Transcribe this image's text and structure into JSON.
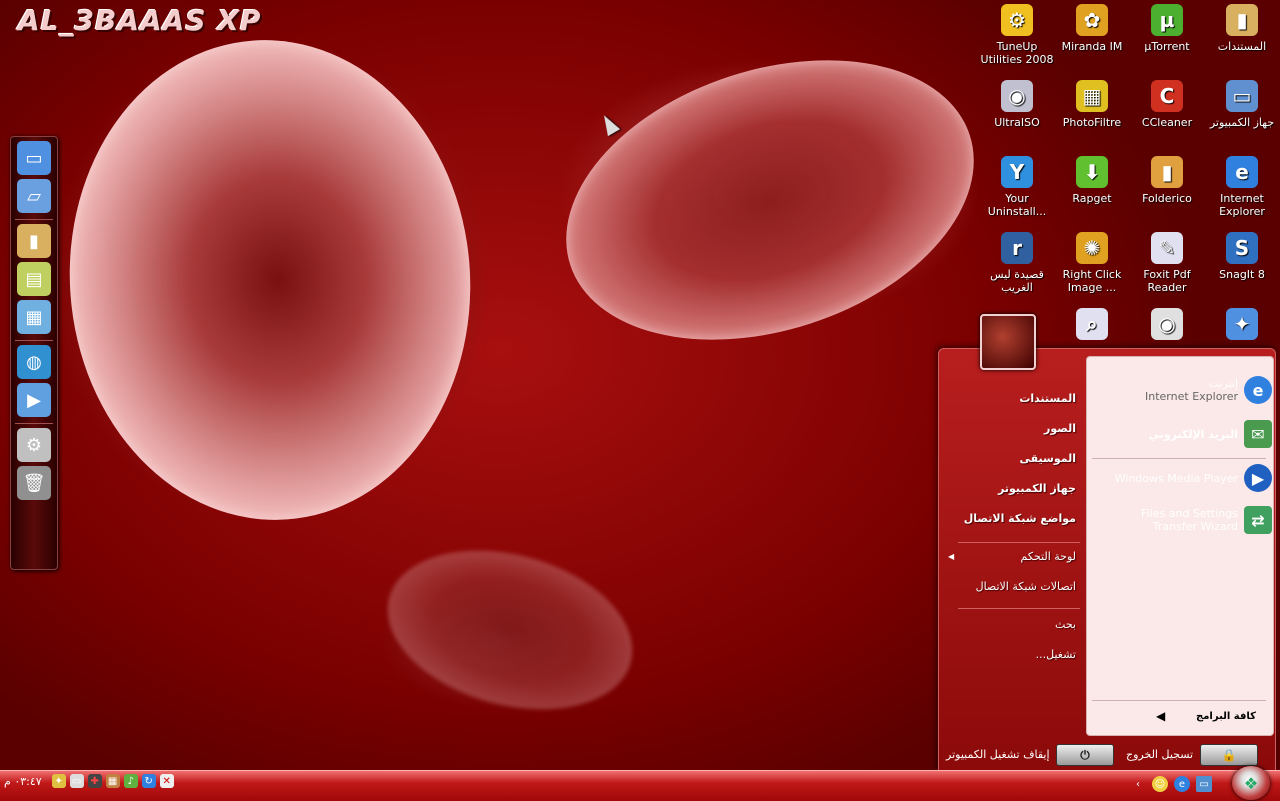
{
  "logo": "AL_3BAAAS XP",
  "desktop_icons": [
    {
      "label": "المستندات",
      "icon": "folder-icon",
      "color": "#d8b060",
      "glyph": "▮"
    },
    {
      "label": "µTorrent",
      "icon": "utorrent-icon",
      "color": "#4caf30",
      "glyph": "µ"
    },
    {
      "label": "Miranda IM",
      "icon": "miranda-icon",
      "color": "#e0a020",
      "glyph": "✿"
    },
    {
      "label": "TuneUp Utilities 2008",
      "icon": "tuneup-icon",
      "color": "#f0c020",
      "glyph": "⚙"
    },
    {
      "label": "جهاز الكمبيوتر",
      "icon": "computer-icon",
      "color": "#6090d0",
      "glyph": "▭"
    },
    {
      "label": "CCleaner",
      "icon": "ccleaner-icon",
      "color": "#d03020",
      "glyph": "C"
    },
    {
      "label": "PhotoFiltre",
      "icon": "photofiltre-icon",
      "color": "#e0c020",
      "glyph": "▦"
    },
    {
      "label": "UltraISO",
      "icon": "ultraiso-icon",
      "color": "#c0c0d0",
      "glyph": "◉"
    },
    {
      "label": "Internet Explorer",
      "icon": "ie-icon",
      "color": "#3080e0",
      "glyph": "e"
    },
    {
      "label": "Folderico",
      "icon": "folderico-icon",
      "color": "#e0a040",
      "glyph": "▮"
    },
    {
      "label": "Rapget",
      "icon": "rapget-icon",
      "color": "#60c030",
      "glyph": "⬇"
    },
    {
      "label": "Your Uninstall...",
      "icon": "uninstaller-icon",
      "color": "#3090e0",
      "glyph": "Y"
    },
    {
      "label": "SnagIt 8",
      "icon": "snagit-icon",
      "color": "#3070c0",
      "glyph": "S"
    },
    {
      "label": "Foxit Pdf Reader",
      "icon": "foxit-icon",
      "color": "#e0e0f0",
      "glyph": "✎"
    },
    {
      "label": "Right Click Image ...",
      "icon": "rightclick-icon",
      "color": "#e0a020",
      "glyph": "✺"
    },
    {
      "label": "قصيدة ليس الغريب",
      "icon": "real-icon",
      "color": "#3060a0",
      "glyph": "r"
    },
    {
      "label": "",
      "icon": "xp-icon",
      "color": "#5090e0",
      "glyph": "✦"
    },
    {
      "label": "",
      "icon": "cd-icon",
      "color": "#e0e0e0",
      "glyph": "◉"
    },
    {
      "label": "",
      "icon": "magnifier-icon",
      "color": "#e0e0f0",
      "glyph": "⌕"
    }
  ],
  "dock_icons": [
    "computer-icon",
    "laptop-icon",
    "folder-icon",
    "documents-icon",
    "pictures-icon",
    "globe-icon",
    "media-icon",
    "settings-icon",
    "recycle-bin-icon"
  ],
  "start_menu": {
    "pinned": [
      {
        "title": "إنترنت",
        "subtitle": "Internet Explorer",
        "icon": "ie-icon"
      },
      {
        "title": "البريد الإلكتروني",
        "subtitle": "",
        "icon": "mail-icon"
      }
    ],
    "recent": [
      {
        "title": "Windows Media Player",
        "icon": "wmp-icon"
      },
      {
        "title": "Files and Settings Transfer Wizard",
        "icon": "transfer-wizard-icon"
      }
    ],
    "all_programs": "كافة البرامج",
    "right_items": [
      {
        "label": "المستندات",
        "bold": true
      },
      {
        "label": "الصور",
        "bold": true
      },
      {
        "label": "الموسيقى",
        "bold": true
      },
      {
        "label": "جهاز الكمبيوتر",
        "bold": true
      },
      {
        "label": "مواضع شبكة الاتصال",
        "bold": true
      },
      {
        "label": "لوحة التحكم",
        "bold": false
      },
      {
        "label": "اتصالات شبكة الاتصال",
        "bold": false
      },
      {
        "label": "بحث",
        "bold": false
      },
      {
        "label": "...تشغيل",
        "bold": false
      }
    ],
    "logoff": "تسجيل الخروج",
    "shutdown": "إيقاف تشغيل الكمبيوتر"
  },
  "taskbar": {
    "clock": "٠٣:٤٧ م"
  }
}
